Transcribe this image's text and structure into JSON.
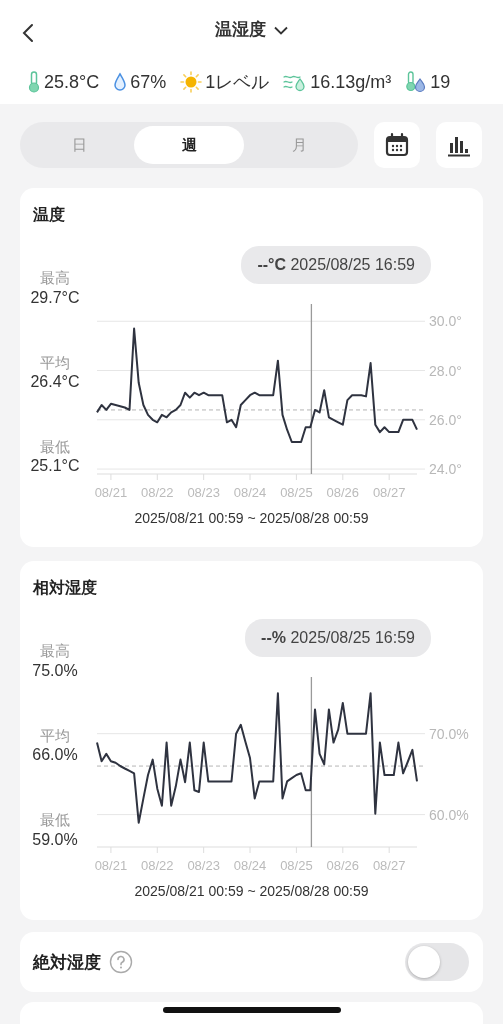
{
  "header": {
    "title": "温湿度"
  },
  "readings": [
    {
      "kind": "thermometer",
      "text": "25.8°C"
    },
    {
      "kind": "drop",
      "text": "67%"
    },
    {
      "kind": "sun",
      "text": "1レベル"
    },
    {
      "kind": "vapor",
      "text": "16.13g/m³"
    },
    {
      "kind": "dewpoint",
      "text": "19"
    }
  ],
  "tabs": [
    {
      "label": "日",
      "selected": false
    },
    {
      "label": "週",
      "selected": true
    },
    {
      "label": "月",
      "selected": false
    }
  ],
  "charts": [
    {
      "title": "温度",
      "stats": [
        {
          "label": "最高",
          "value": "29.7°C"
        },
        {
          "label": "平均",
          "value": "26.4°C"
        },
        {
          "label": "最低",
          "value": "25.1°C"
        }
      ],
      "tooltip": "**--°C** 2025/08/25 16:59",
      "range": "2025/08/21 00:59 ~ 2025/08/28 00:59",
      "chart_data": {
        "type": "line",
        "grid": true,
        "ylim": [
          23.8,
          30.7
        ],
        "categories": [
          null,
          null,
          null,
          "08/21",
          null,
          null,
          null,
          null,
          null,
          null,
          null,
          null,
          null,
          "08/22",
          null,
          null,
          null,
          null,
          null,
          null,
          null,
          null,
          null,
          "08/23",
          null,
          null,
          null,
          null,
          null,
          null,
          null,
          null,
          null,
          "08/24",
          null,
          null,
          null,
          null,
          null,
          null,
          null,
          null,
          null,
          "08/25",
          null,
          null,
          null,
          null,
          null,
          null,
          null,
          null,
          null,
          "08/26",
          null,
          null,
          null,
          null,
          null,
          null,
          null,
          null,
          null,
          "08/27",
          null,
          null,
          null,
          null,
          null,
          null
        ],
        "yticks": [
          {
            "value": 24,
            "label": "24.0°"
          },
          {
            "value": 26,
            "label": "26.0°"
          },
          {
            "value": 28,
            "label": "28.0°"
          },
          {
            "value": 30,
            "label": "30.0°"
          }
        ],
        "series": [
          {
            "color": "#2f3340",
            "values": [
              26.3,
              26.6,
              26.4,
              26.65,
              26.6,
              26.55,
              26.5,
              26.4,
              29.7,
              27.5,
              26.6,
              26.2,
              26.0,
              25.9,
              26.2,
              26.1,
              26.3,
              26.4,
              26.6,
              27.1,
              26.9,
              27.1,
              27.0,
              27.1,
              27.0,
              27.0,
              27.0,
              27.0,
              25.9,
              26.0,
              25.7,
              26.6,
              26.8,
              27.0,
              27.1,
              27.0,
              27.0,
              27.0,
              27.0,
              28.4,
              26.2,
              25.6,
              25.1,
              25.1,
              25.1,
              25.7,
              25.7,
              26.4,
              26.3,
              27.2,
              26.1,
              26.0,
              25.9,
              25.8,
              26.8,
              27.0,
              27.0,
              27.0,
              26.95,
              28.3,
              25.8,
              25.5,
              25.7,
              25.5,
              25.5,
              25.5,
              26.0,
              26.0,
              26.0,
              25.6
            ]
          }
        ],
        "ref_lines": [
          {
            "axis": "y",
            "value": 26.4
          }
        ]
      }
    },
    {
      "title": "相対湿度",
      "stats": [
        {
          "label": "最高",
          "value": "75.0%"
        },
        {
          "label": "平均",
          "value": "66.0%"
        },
        {
          "label": "最低",
          "value": "59.0%"
        }
      ],
      "tooltip": "**--%** 2025/08/25 16:59",
      "range": "2025/08/21 00:59 ~ 2025/08/28 00:59",
      "chart_data": {
        "type": "line",
        "grid": true,
        "ylim": [
          56,
          77
        ],
        "categories": [
          null,
          null,
          null,
          "08/21",
          null,
          null,
          null,
          null,
          null,
          null,
          null,
          null,
          null,
          "08/22",
          null,
          null,
          null,
          null,
          null,
          null,
          null,
          null,
          null,
          "08/23",
          null,
          null,
          null,
          null,
          null,
          null,
          null,
          null,
          null,
          "08/24",
          null,
          null,
          null,
          null,
          null,
          null,
          null,
          null,
          null,
          "08/25",
          null,
          null,
          null,
          null,
          null,
          null,
          null,
          null,
          null,
          "08/26",
          null,
          null,
          null,
          null,
          null,
          null,
          null,
          null,
          null,
          "08/27",
          null,
          null,
          null,
          null,
          null,
          null
        ],
        "yticks": [
          {
            "value": 60,
            "label": "60.0%"
          },
          {
            "value": 70,
            "label": "70.0%"
          }
        ],
        "series": [
          {
            "color": "#2f3340",
            "values": [
              68.9,
              66.6,
              67.5,
              66.6,
              66.4,
              66.0,
              65.7,
              65.4,
              65.1,
              59.0,
              62.0,
              64.9,
              66.8,
              63.2,
              61.1,
              68.9,
              61.1,
              63.5,
              66.8,
              64.0,
              68.9,
              63.0,
              62.8,
              68.9,
              64.1,
              64.1,
              64.1,
              64.1,
              64.1,
              64.1,
              70.0,
              71.1,
              69.0,
              67.0,
              62.0,
              64.1,
              64.1,
              64.1,
              64.1,
              75.0,
              62.0,
              64.1,
              64.5,
              64.9,
              65.1,
              63.0,
              63.0,
              73.0,
              67.5,
              66.2,
              73.0,
              68.9,
              70.5,
              73.8,
              70.0,
              70.0,
              70.0,
              70.0,
              70.0,
              75.0,
              60.1,
              68.9,
              64.9,
              64.9,
              64.9,
              68.9,
              65.1,
              66.5,
              68.0,
              64.1
            ]
          }
        ],
        "ref_lines": [
          {
            "axis": "y",
            "value": 66.0
          }
        ]
      }
    }
  ],
  "toggle_card": {
    "label": "絶対湿度",
    "on": false
  }
}
